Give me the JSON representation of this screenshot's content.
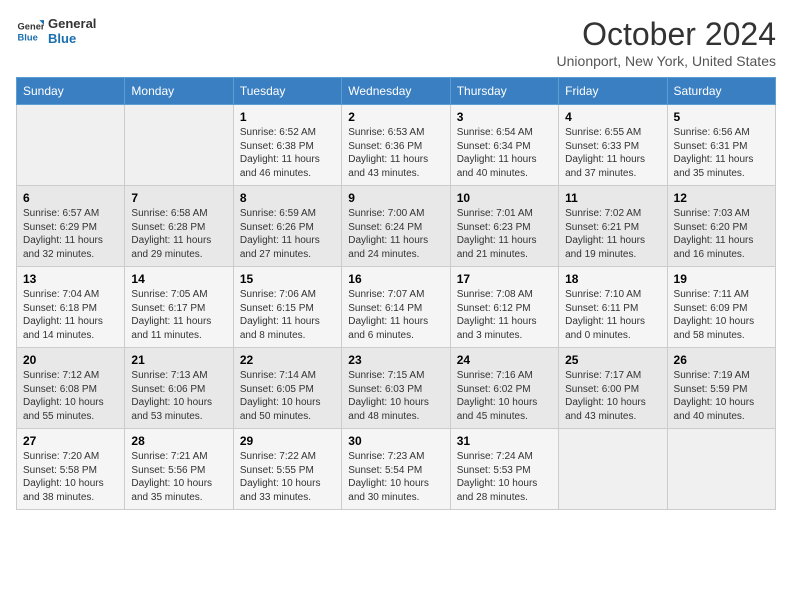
{
  "logo": {
    "line1": "General",
    "line2": "Blue"
  },
  "title": "October 2024",
  "location": "Unionport, New York, United States",
  "days_of_week": [
    "Sunday",
    "Monday",
    "Tuesday",
    "Wednesday",
    "Thursday",
    "Friday",
    "Saturday"
  ],
  "weeks": [
    [
      {
        "day": "",
        "sunrise": "",
        "sunset": "",
        "daylight": ""
      },
      {
        "day": "",
        "sunrise": "",
        "sunset": "",
        "daylight": ""
      },
      {
        "day": "1",
        "sunrise": "Sunrise: 6:52 AM",
        "sunset": "Sunset: 6:38 PM",
        "daylight": "Daylight: 11 hours and 46 minutes."
      },
      {
        "day": "2",
        "sunrise": "Sunrise: 6:53 AM",
        "sunset": "Sunset: 6:36 PM",
        "daylight": "Daylight: 11 hours and 43 minutes."
      },
      {
        "day": "3",
        "sunrise": "Sunrise: 6:54 AM",
        "sunset": "Sunset: 6:34 PM",
        "daylight": "Daylight: 11 hours and 40 minutes."
      },
      {
        "day": "4",
        "sunrise": "Sunrise: 6:55 AM",
        "sunset": "Sunset: 6:33 PM",
        "daylight": "Daylight: 11 hours and 37 minutes."
      },
      {
        "day": "5",
        "sunrise": "Sunrise: 6:56 AM",
        "sunset": "Sunset: 6:31 PM",
        "daylight": "Daylight: 11 hours and 35 minutes."
      }
    ],
    [
      {
        "day": "6",
        "sunrise": "Sunrise: 6:57 AM",
        "sunset": "Sunset: 6:29 PM",
        "daylight": "Daylight: 11 hours and 32 minutes."
      },
      {
        "day": "7",
        "sunrise": "Sunrise: 6:58 AM",
        "sunset": "Sunset: 6:28 PM",
        "daylight": "Daylight: 11 hours and 29 minutes."
      },
      {
        "day": "8",
        "sunrise": "Sunrise: 6:59 AM",
        "sunset": "Sunset: 6:26 PM",
        "daylight": "Daylight: 11 hours and 27 minutes."
      },
      {
        "day": "9",
        "sunrise": "Sunrise: 7:00 AM",
        "sunset": "Sunset: 6:24 PM",
        "daylight": "Daylight: 11 hours and 24 minutes."
      },
      {
        "day": "10",
        "sunrise": "Sunrise: 7:01 AM",
        "sunset": "Sunset: 6:23 PM",
        "daylight": "Daylight: 11 hours and 21 minutes."
      },
      {
        "day": "11",
        "sunrise": "Sunrise: 7:02 AM",
        "sunset": "Sunset: 6:21 PM",
        "daylight": "Daylight: 11 hours and 19 minutes."
      },
      {
        "day": "12",
        "sunrise": "Sunrise: 7:03 AM",
        "sunset": "Sunset: 6:20 PM",
        "daylight": "Daylight: 11 hours and 16 minutes."
      }
    ],
    [
      {
        "day": "13",
        "sunrise": "Sunrise: 7:04 AM",
        "sunset": "Sunset: 6:18 PM",
        "daylight": "Daylight: 11 hours and 14 minutes."
      },
      {
        "day": "14",
        "sunrise": "Sunrise: 7:05 AM",
        "sunset": "Sunset: 6:17 PM",
        "daylight": "Daylight: 11 hours and 11 minutes."
      },
      {
        "day": "15",
        "sunrise": "Sunrise: 7:06 AM",
        "sunset": "Sunset: 6:15 PM",
        "daylight": "Daylight: 11 hours and 8 minutes."
      },
      {
        "day": "16",
        "sunrise": "Sunrise: 7:07 AM",
        "sunset": "Sunset: 6:14 PM",
        "daylight": "Daylight: 11 hours and 6 minutes."
      },
      {
        "day": "17",
        "sunrise": "Sunrise: 7:08 AM",
        "sunset": "Sunset: 6:12 PM",
        "daylight": "Daylight: 11 hours and 3 minutes."
      },
      {
        "day": "18",
        "sunrise": "Sunrise: 7:10 AM",
        "sunset": "Sunset: 6:11 PM",
        "daylight": "Daylight: 11 hours and 0 minutes."
      },
      {
        "day": "19",
        "sunrise": "Sunrise: 7:11 AM",
        "sunset": "Sunset: 6:09 PM",
        "daylight": "Daylight: 10 hours and 58 minutes."
      }
    ],
    [
      {
        "day": "20",
        "sunrise": "Sunrise: 7:12 AM",
        "sunset": "Sunset: 6:08 PM",
        "daylight": "Daylight: 10 hours and 55 minutes."
      },
      {
        "day": "21",
        "sunrise": "Sunrise: 7:13 AM",
        "sunset": "Sunset: 6:06 PM",
        "daylight": "Daylight: 10 hours and 53 minutes."
      },
      {
        "day": "22",
        "sunrise": "Sunrise: 7:14 AM",
        "sunset": "Sunset: 6:05 PM",
        "daylight": "Daylight: 10 hours and 50 minutes."
      },
      {
        "day": "23",
        "sunrise": "Sunrise: 7:15 AM",
        "sunset": "Sunset: 6:03 PM",
        "daylight": "Daylight: 10 hours and 48 minutes."
      },
      {
        "day": "24",
        "sunrise": "Sunrise: 7:16 AM",
        "sunset": "Sunset: 6:02 PM",
        "daylight": "Daylight: 10 hours and 45 minutes."
      },
      {
        "day": "25",
        "sunrise": "Sunrise: 7:17 AM",
        "sunset": "Sunset: 6:00 PM",
        "daylight": "Daylight: 10 hours and 43 minutes."
      },
      {
        "day": "26",
        "sunrise": "Sunrise: 7:19 AM",
        "sunset": "Sunset: 5:59 PM",
        "daylight": "Daylight: 10 hours and 40 minutes."
      }
    ],
    [
      {
        "day": "27",
        "sunrise": "Sunrise: 7:20 AM",
        "sunset": "Sunset: 5:58 PM",
        "daylight": "Daylight: 10 hours and 38 minutes."
      },
      {
        "day": "28",
        "sunrise": "Sunrise: 7:21 AM",
        "sunset": "Sunset: 5:56 PM",
        "daylight": "Daylight: 10 hours and 35 minutes."
      },
      {
        "day": "29",
        "sunrise": "Sunrise: 7:22 AM",
        "sunset": "Sunset: 5:55 PM",
        "daylight": "Daylight: 10 hours and 33 minutes."
      },
      {
        "day": "30",
        "sunrise": "Sunrise: 7:23 AM",
        "sunset": "Sunset: 5:54 PM",
        "daylight": "Daylight: 10 hours and 30 minutes."
      },
      {
        "day": "31",
        "sunrise": "Sunrise: 7:24 AM",
        "sunset": "Sunset: 5:53 PM",
        "daylight": "Daylight: 10 hours and 28 minutes."
      },
      {
        "day": "",
        "sunrise": "",
        "sunset": "",
        "daylight": ""
      },
      {
        "day": "",
        "sunrise": "",
        "sunset": "",
        "daylight": ""
      }
    ]
  ]
}
